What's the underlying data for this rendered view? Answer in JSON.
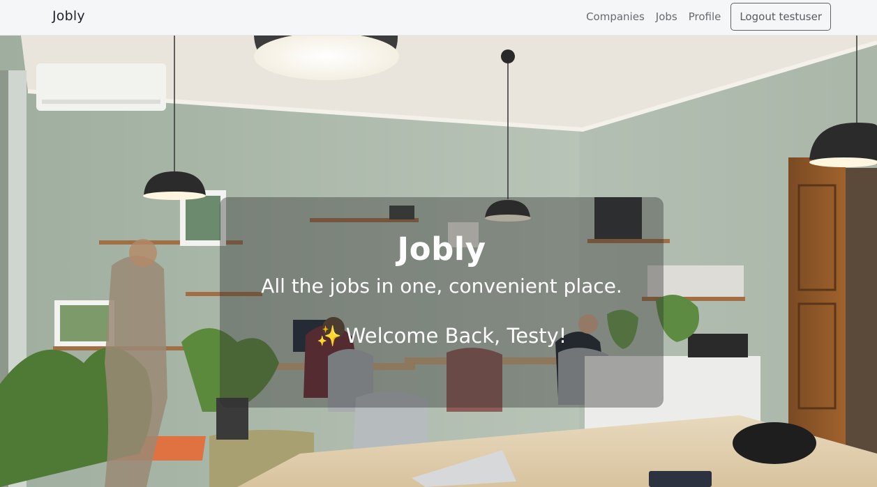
{
  "navbar": {
    "brand": "Jobly",
    "links": {
      "companies": "Companies",
      "jobs": "Jobs",
      "profile": "Profile"
    },
    "logout_label": "Logout testuser"
  },
  "hero": {
    "title": "Jobly",
    "tagline": "All the jobs in one, convenient place.",
    "welcome_icon": "✨",
    "welcome_text": "Welcome Back, Testy!",
    "background_description_icon": "office-photo-background"
  },
  "colors": {
    "navbar_bg": "#f5f6f8",
    "overlay_bg": "rgba(45,45,45,0.38)",
    "text_light": "#ffffff"
  }
}
